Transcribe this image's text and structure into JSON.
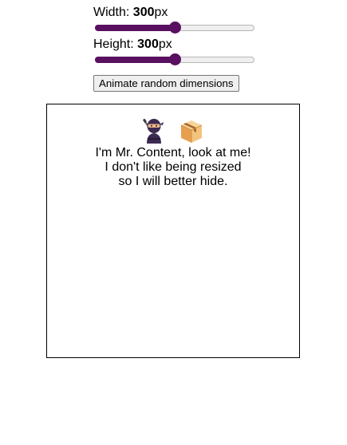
{
  "controls": {
    "width": {
      "label": "Width: ",
      "value": "300",
      "unit": "px",
      "fill": 0.5
    },
    "height": {
      "label": "Height: ",
      "value": "300",
      "unit": "px",
      "fill": 0.5
    },
    "animate_button": "Animate random dimensions"
  },
  "content": {
    "icons": [
      "ninja-icon",
      "package-icon"
    ],
    "lines": [
      "I'm Mr. Content, look at me!",
      "I don't like being resized",
      "so I will better hide."
    ]
  },
  "colors": {
    "slider_accent": "#5a1060"
  }
}
